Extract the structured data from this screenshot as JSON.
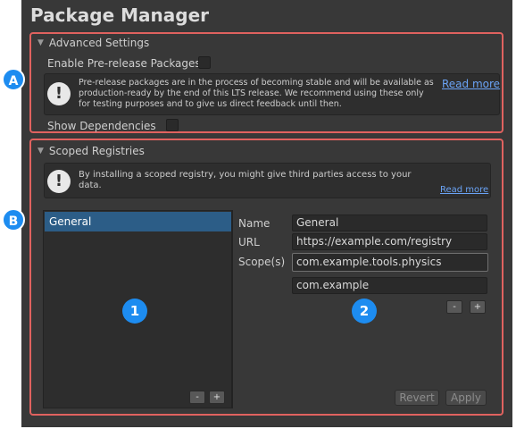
{
  "window": {
    "title": "Package Manager"
  },
  "advanced": {
    "foldout_label": "Advanced Settings",
    "prerelease_label": "Enable Pre-release Packages",
    "help_lines": [
      "Pre-release packages are in the process of becoming stable and will be available as",
      "production-ready by the end of this LTS release. We recommend using these only",
      "for testing purposes and to give us direct feedback until then."
    ],
    "read_more": "Read more",
    "show_dependencies_label": "Show Dependencies"
  },
  "scoped": {
    "foldout_label": "Scoped Registries",
    "help_text": "By installing a scoped registry, you might give third parties access to your data.",
    "read_more": "Read more",
    "registries": [
      "General"
    ],
    "name_label": "Name",
    "name_value": "General",
    "url_label": "URL",
    "url_value": "https://example.com/registry",
    "scopes_label": "Scope(s)",
    "scopes": [
      "com.example.tools.physics",
      "com.example"
    ],
    "minus": "-",
    "plus": "+",
    "revert_label": "Revert",
    "apply_label": "Apply"
  },
  "callouts": {
    "a": "A",
    "b": "B",
    "one": "1",
    "two": "2"
  },
  "colors": {
    "highlight_border": "#e0625f",
    "callout_blue": "#1d8cf0",
    "selection": "#2c5d87",
    "link": "#6aa3f5"
  },
  "icons": {
    "warning": "exclamation-icon",
    "foldout": "triangle-down-icon"
  }
}
